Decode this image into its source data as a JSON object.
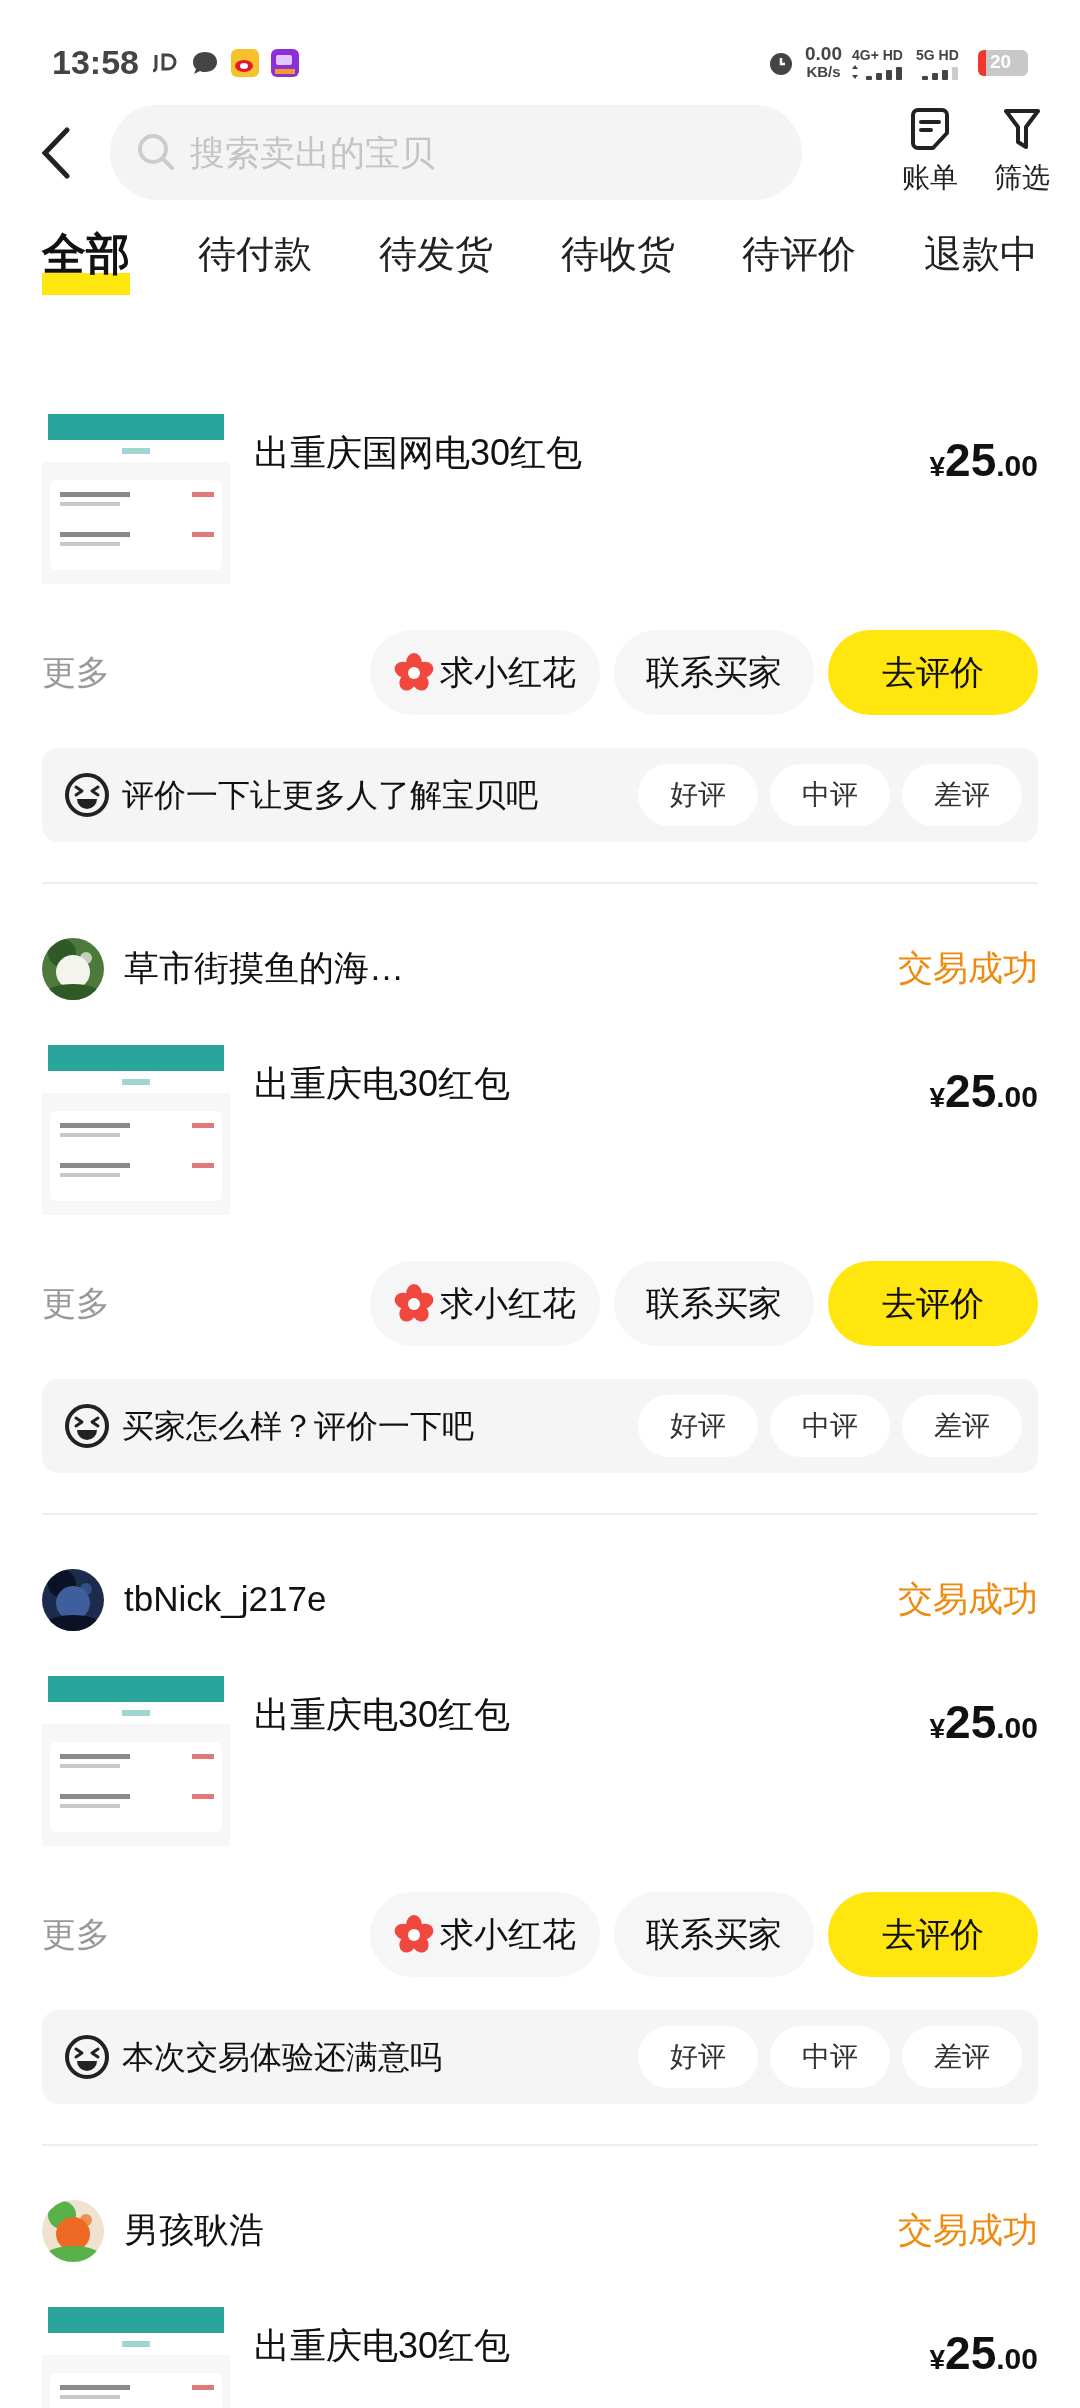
{
  "status_bar": {
    "time": "13:58",
    "app_icons": [
      {
        "kind": "jd"
      },
      {
        "kind": "chat"
      },
      {
        "kind": "weibo"
      },
      {
        "kind": "bank"
      }
    ],
    "speed": "0.00",
    "speed_unit": "KB/s",
    "net1": "4G+ HD",
    "net2": "5G HD",
    "battery": "20"
  },
  "header": {
    "search": {
      "placeholder": "搜索卖出的宝贝"
    },
    "actions": [
      {
        "kind": "bill",
        "label": "账单"
      },
      {
        "kind": "filter",
        "label": "筛选"
      }
    ]
  },
  "tabs": [
    {
      "label": "全部",
      "selected": true
    },
    {
      "label": "待付款",
      "selected": false
    },
    {
      "label": "待发货",
      "selected": false
    },
    {
      "label": "待收货",
      "selected": false
    },
    {
      "label": "待评价",
      "selected": false
    },
    {
      "label": "退款中",
      "selected": false
    }
  ],
  "orders": [
    {
      "title": "出重庆国网电30红包",
      "price": {
        "currency": "¥",
        "integer": "25",
        "decimal": ".00"
      },
      "more": "更多",
      "buttons": [
        {
          "kind": "flower",
          "label": "求小红花"
        },
        {
          "kind": "plain",
          "label": "联系买家"
        },
        {
          "kind": "primary",
          "label": "去评价"
        }
      ],
      "review": {
        "prompt": "评价一下让更多人了解宝贝吧",
        "options": [
          "好评",
          "中评",
          "差评"
        ]
      }
    },
    {
      "buyer": {
        "name": "草市街摸鱼的海…",
        "avatar": {
          "kind": "flower"
        }
      },
      "status": "交易成功",
      "title": "出重庆电30红包",
      "price": {
        "currency": "¥",
        "integer": "25",
        "decimal": ".00"
      },
      "more": "更多",
      "buttons": [
        {
          "kind": "flower",
          "label": "求小红花"
        },
        {
          "kind": "plain",
          "label": "联系买家"
        },
        {
          "kind": "primary",
          "label": "去评价"
        }
      ],
      "review": {
        "prompt": "买家怎么样？评价一下吧",
        "options": [
          "好评",
          "中评",
          "差评"
        ]
      }
    },
    {
      "buyer": {
        "name": "tbNick_j217e",
        "avatar": {
          "kind": "dark"
        }
      },
      "status": "交易成功",
      "title": "出重庆电30红包",
      "price": {
        "currency": "¥",
        "integer": "25",
        "decimal": ".00"
      },
      "more": "更多",
      "buttons": [
        {
          "kind": "flower",
          "label": "求小红花"
        },
        {
          "kind": "plain",
          "label": "联系买家"
        },
        {
          "kind": "primary",
          "label": "去评价"
        }
      ],
      "review": {
        "prompt": "本次交易体验还满意吗",
        "options": [
          "好评",
          "中评",
          "差评"
        ]
      }
    },
    {
      "buyer": {
        "name": "男孩耿浩",
        "avatar": {
          "kind": "carrot"
        }
      },
      "status": "交易成功",
      "title": "出重庆电30红包",
      "price": {
        "currency": "¥",
        "integer": "25",
        "decimal": ".00"
      }
    }
  ]
}
